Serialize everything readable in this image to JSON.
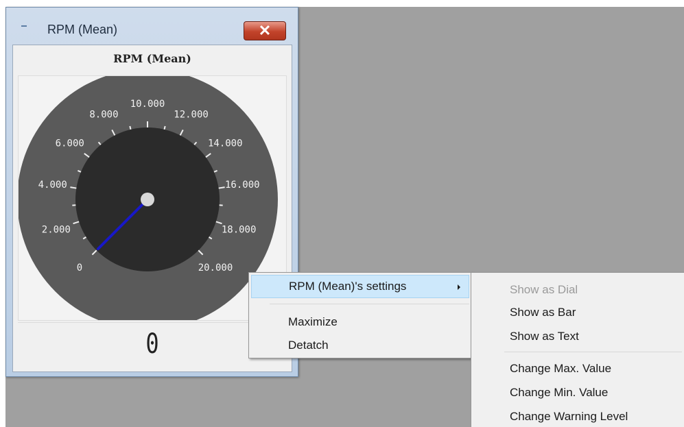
{
  "window": {
    "title": "RPM (Mean)",
    "close_glyph": "✕"
  },
  "gauge": {
    "title": "RPM (Mean)",
    "value": 0,
    "min": 0,
    "max": 20000,
    "tick_labels": [
      "0",
      "2.000",
      "4.000",
      "6.000",
      "8.000",
      "10.000",
      "12.000",
      "14.000",
      "16.000",
      "18.000",
      "20.000"
    ],
    "readout": "0",
    "colors": {
      "outer_ring": "#5a5a5a",
      "dial_face": "#2b2b2b",
      "needle": "#1818c8",
      "hub": "#d8d8d8"
    }
  },
  "context_menu": {
    "items": [
      {
        "label": "RPM (Mean)'s settings",
        "has_submenu": true,
        "highlighted": true
      },
      {
        "label": "Maximize"
      },
      {
        "label": "Detatch"
      }
    ]
  },
  "submenu": {
    "items": [
      {
        "label": "Show as Dial",
        "disabled": true
      },
      {
        "label": "Show as Bar"
      },
      {
        "label": "Show as Text"
      },
      {
        "label": "Change Max. Value"
      },
      {
        "label": "Change Min. Value"
      },
      {
        "label": "Change Warning Level"
      }
    ]
  }
}
